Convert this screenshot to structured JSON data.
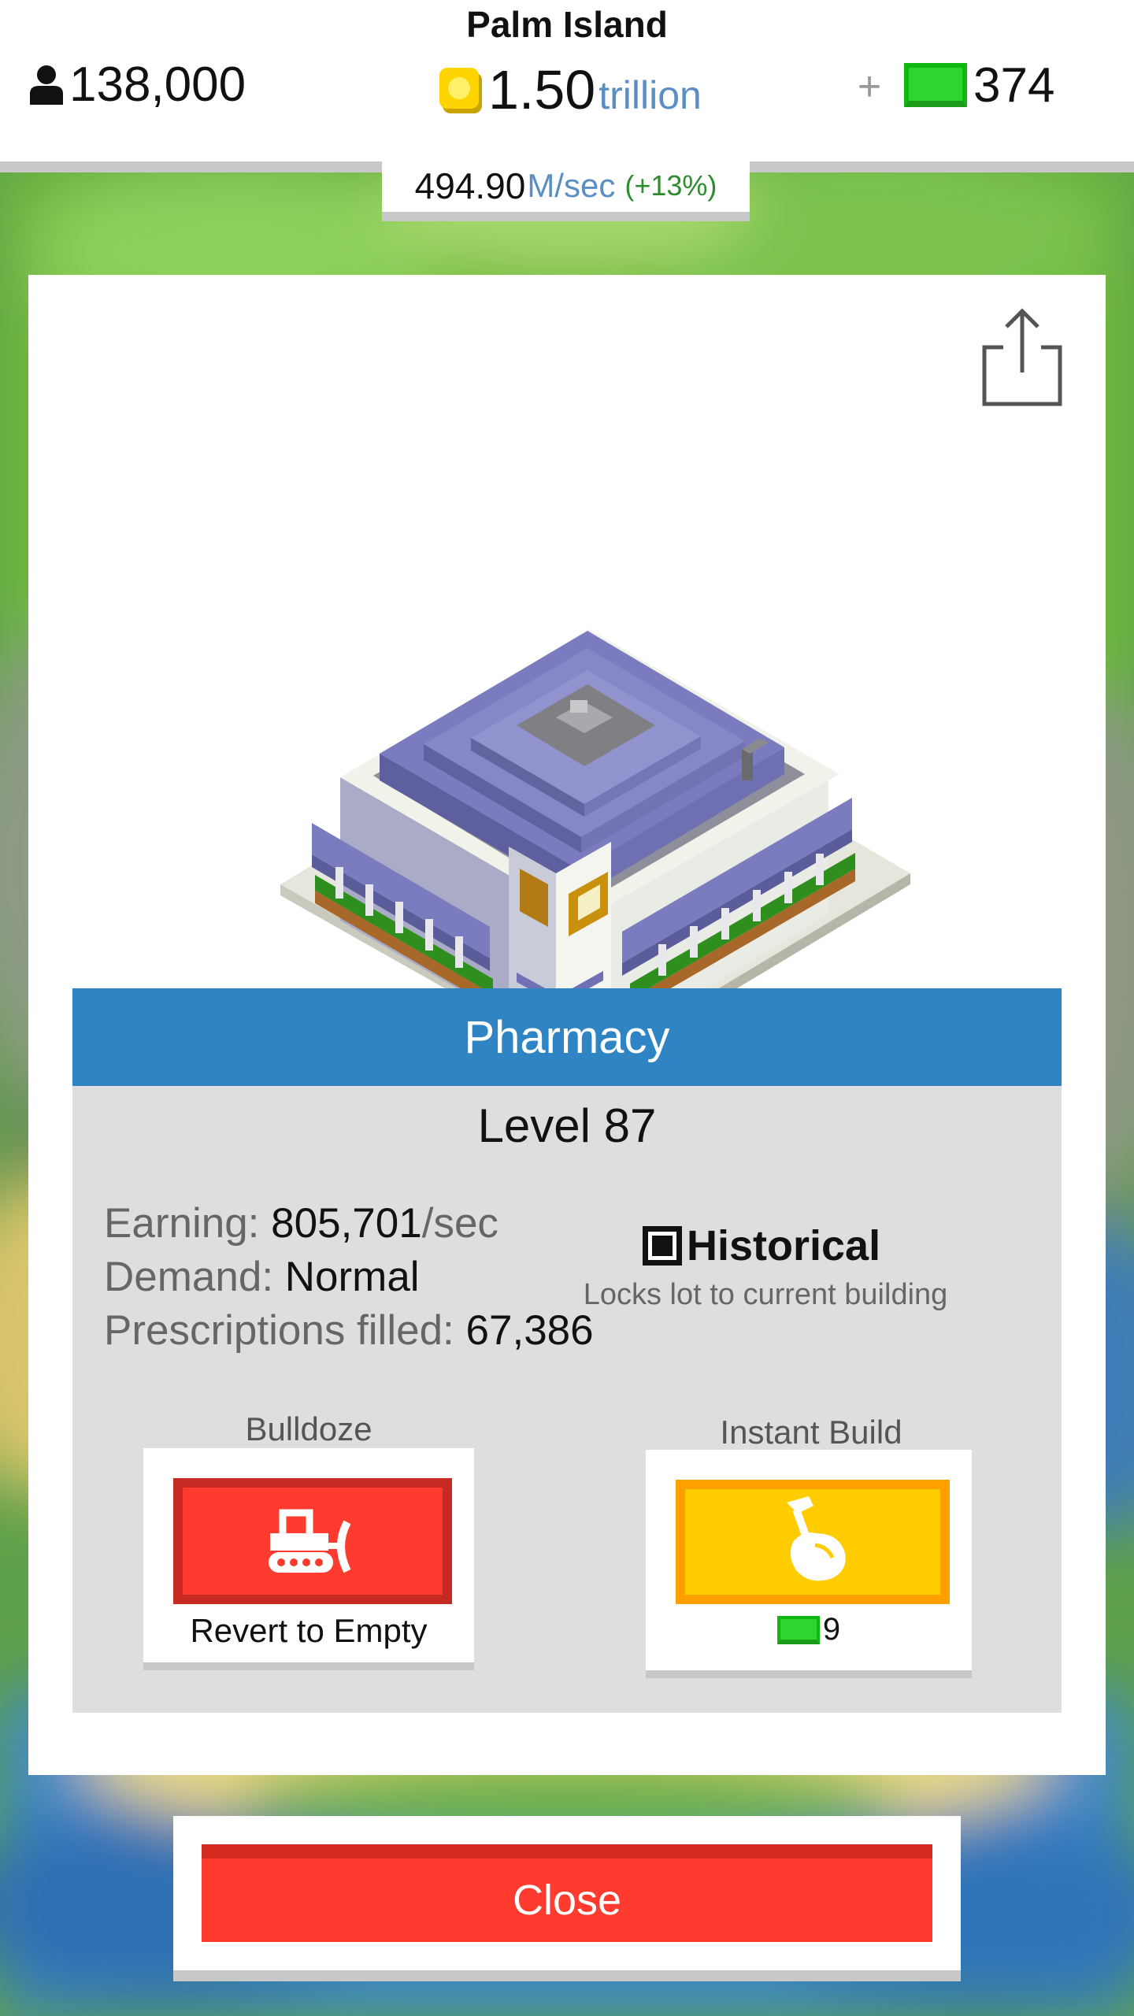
{
  "hud": {
    "island_name": "Palm Island",
    "population": "138,000",
    "coins_amount": "1.50",
    "coins_unit": "trillion",
    "buy_cash_symbol": "+",
    "cash": "374",
    "income": {
      "amount": "494.90",
      "unit": "M/sec",
      "bonus": "(+13%)"
    }
  },
  "panel": {
    "share_icon": "share-icon",
    "building_image": "pharmacy-building",
    "title": "Pharmacy",
    "level": "Level 87",
    "stats": {
      "earning_label": "Earning: ",
      "earning_value": "805,701",
      "earning_unit": "/sec",
      "demand_label": "Demand: ",
      "demand_value": "Normal",
      "prescriptions_label": "Prescriptions filled: ",
      "prescriptions_value": "67,386"
    },
    "historical": {
      "label": "Historical",
      "description": "Locks lot to current building",
      "checked": true
    },
    "bulldoze": {
      "label": "Bulldoze",
      "icon": "bulldozer-icon",
      "caption": "Revert to Empty"
    },
    "instant_build": {
      "label": "Instant Build",
      "icon": "hammer-hand-icon",
      "cost": "9"
    }
  },
  "close_label": "Close",
  "colors": {
    "title_bar": "#2f85c4",
    "close_red": "#ff3b2f",
    "instant_yellow": "#ffcc00",
    "cash_green": "#2fd52f",
    "coin_gold": "#ffd400"
  }
}
